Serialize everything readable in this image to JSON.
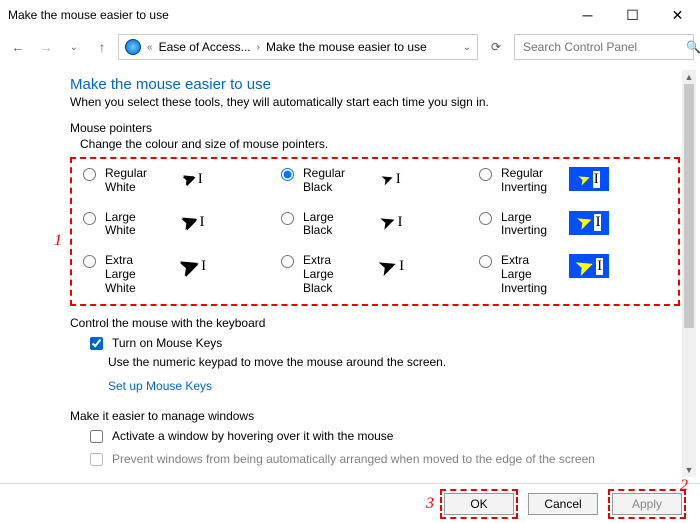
{
  "window": {
    "title": "Make the mouse easier to use"
  },
  "breadcrumb": {
    "root": "«",
    "crumb1": "Ease of Access...",
    "crumb2": "Make the mouse easier to use"
  },
  "search": {
    "placeholder": "Search Control Panel"
  },
  "header": {
    "title": "Make the mouse easier to use",
    "subtitle": "When you select these tools, they will automatically start each time you sign in."
  },
  "pointers": {
    "section": "Mouse pointers",
    "instruction": "Change the colour and size of mouse pointers.",
    "options": [
      {
        "id": "regular-white",
        "label": "Regular White",
        "selected": false
      },
      {
        "id": "regular-black",
        "label": "Regular Black",
        "selected": true
      },
      {
        "id": "regular-inverting",
        "label": "Regular Inverting",
        "selected": false
      },
      {
        "id": "large-white",
        "label": "Large White",
        "selected": false
      },
      {
        "id": "large-black",
        "label": "Large Black",
        "selected": false
      },
      {
        "id": "large-inverting",
        "label": "Large Inverting",
        "selected": false
      },
      {
        "id": "extra-large-white",
        "label": "Extra Large White",
        "selected": false
      },
      {
        "id": "extra-large-black",
        "label": "Extra Large Black",
        "selected": false
      },
      {
        "id": "extra-large-inverting",
        "label": "Extra Large Inverting",
        "selected": false
      }
    ]
  },
  "keyboard": {
    "section": "Control the mouse with the keyboard",
    "mousekeys_label": "Turn on Mouse Keys",
    "mousekeys_checked": true,
    "mousekeys_desc": "Use the numeric keypad to move the mouse around the screen.",
    "setup_link": "Set up Mouse Keys"
  },
  "windows": {
    "section": "Make it easier to manage windows",
    "opt1_label": "Activate a window by hovering over it with the mouse",
    "opt1_checked": false,
    "opt2_label_truncated": "Prevent windows from being automatically arranged when moved to the edge of the screen",
    "opt2_checked": false
  },
  "footer": {
    "ok": "OK",
    "cancel": "Cancel",
    "apply": "Apply"
  },
  "annotations": {
    "a1": "1",
    "a2": "2",
    "a3": "3"
  }
}
